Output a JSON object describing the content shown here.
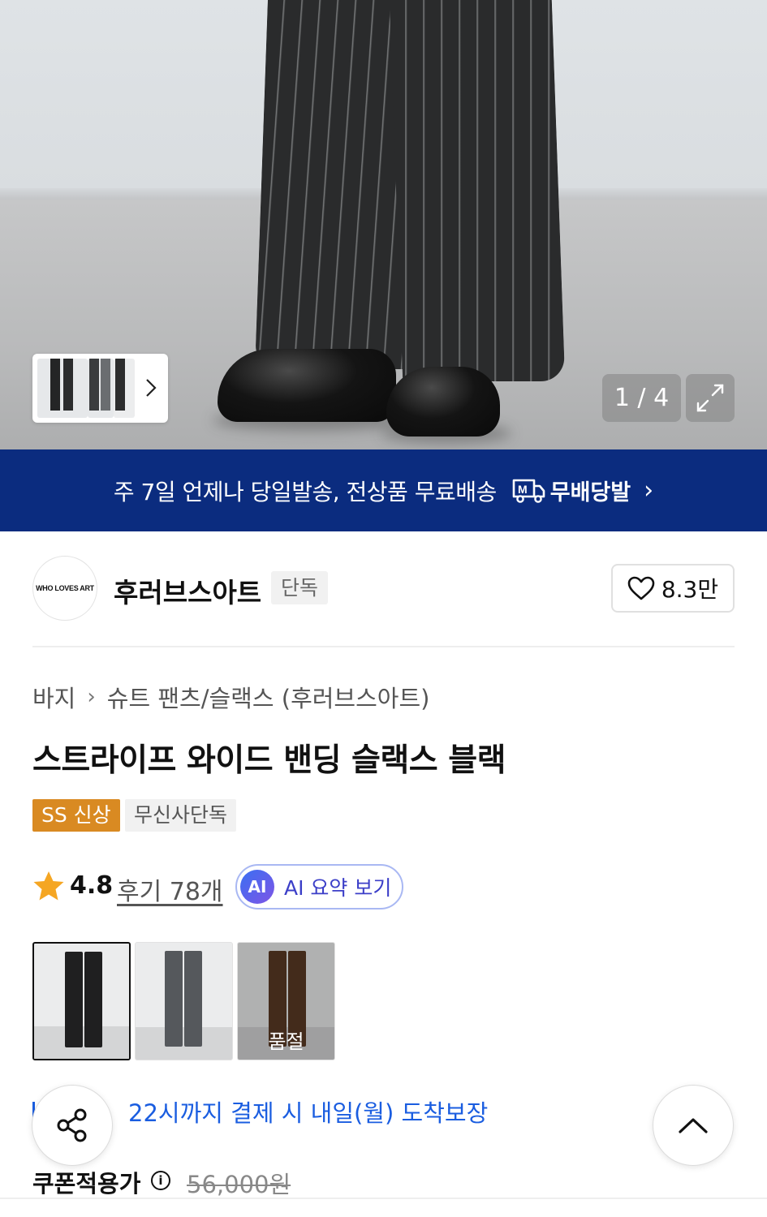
{
  "hero": {
    "counter": "1 / 4",
    "expand_icon": "expand-icon",
    "thumb_next_icon": "chevron-right-icon"
  },
  "banner": {
    "text": "주 7일 언제나 당일발송, 전상품 무료배송",
    "logo_text": "무배당발",
    "logo_icon": "truck-m-icon",
    "chevron": "›"
  },
  "brand": {
    "avatar_text": "WHO LOVES ART",
    "name": "후러브스아트",
    "tag": "단독",
    "likes": "8.3만"
  },
  "breadcrumb": {
    "category": "바지",
    "separator": "›",
    "subcategory": "슈트 팬츠/슬랙스 (후러브스아트)"
  },
  "product": {
    "title": "스트라이프 와이드 밴딩 슬랙스 블랙",
    "badge_new": "SS 신상",
    "badge_exclusive": "무신사단독"
  },
  "rating": {
    "score": "4.8",
    "review_link": "후기 78개",
    "ai_icon_text": "AI",
    "ai_button": "AI 요약 보기"
  },
  "colors": {
    "options": [
      {
        "name": "black",
        "swatch": "#1f1f20",
        "selected": true
      },
      {
        "name": "gray",
        "swatch": "#55585c",
        "selected": false
      },
      {
        "name": "brown",
        "swatch": "#5a3a24",
        "selected": false,
        "status": "품절"
      }
    ]
  },
  "delivery": {
    "text": "22시까지 결제 시 내일(월) 도착보장"
  },
  "price": {
    "label": "쿠폰적용가",
    "info_icon": "i",
    "original": "56,000원"
  },
  "fab": {
    "share_icon": "share-icon",
    "top_icon": "chevron-up-icon"
  },
  "theme": {
    "banner_bg": "#0b2c7f",
    "badge_new_bg": "#d98a22",
    "delivery_color": "#1a5de0",
    "ai_text_color": "#3c3fc8"
  }
}
